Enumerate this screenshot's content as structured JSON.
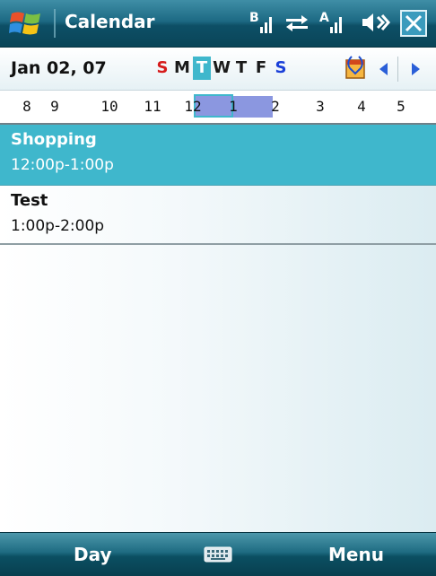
{
  "titlebar": {
    "app_title": "Calendar",
    "icons": [
      "windows-start-icon",
      "bluetooth-signal-icon",
      "connectivity-arrows-icon",
      "signal-strength-icon",
      "speaker-icon",
      "close-icon"
    ]
  },
  "datebar": {
    "date_label": "Jan 02, 07",
    "week_days": [
      {
        "label": "S",
        "kind": "sunday"
      },
      {
        "label": "M",
        "kind": "weekday"
      },
      {
        "label": "T",
        "kind": "selected"
      },
      {
        "label": "W",
        "kind": "weekday"
      },
      {
        "label": "T",
        "kind": "weekday"
      },
      {
        "label": "F",
        "kind": "weekday"
      },
      {
        "label": "S",
        "kind": "saturday"
      }
    ]
  },
  "hourstrip": {
    "hours": [
      "8",
      "9",
      "10",
      "11",
      "12",
      "1",
      "2",
      "3",
      "4",
      "5"
    ]
  },
  "appointments": [
    {
      "title": "Shopping",
      "time": "12:00p-1:00p",
      "selected": true
    },
    {
      "title": "Test",
      "time": "1:00p-2:00p",
      "selected": false
    }
  ],
  "softkeys": {
    "left": "Day",
    "right": "Menu"
  },
  "colors": {
    "accent": "#3fb7cc",
    "busy_block": "#8b97e0",
    "sunday": "#d61b1b",
    "saturday": "#1a3fd8"
  }
}
